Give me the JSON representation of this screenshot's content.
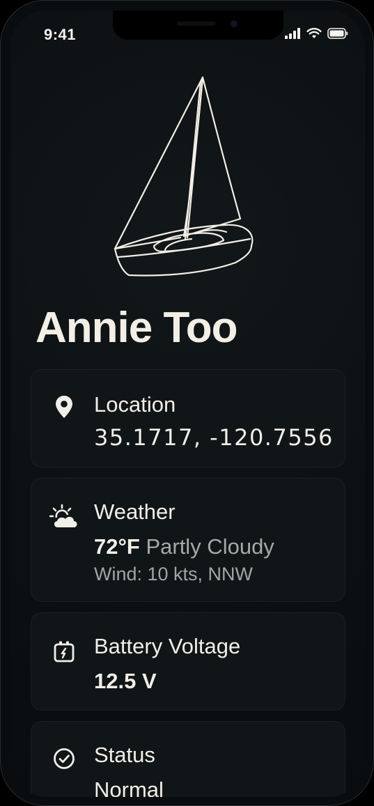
{
  "status_bar": {
    "time": "9:41"
  },
  "boat": {
    "name": "Annie Too"
  },
  "cards": {
    "location": {
      "title": "Location",
      "value": "35.1717, -120.7556",
      "icon": "location-pin-icon"
    },
    "weather": {
      "title": "Weather",
      "temperature": "72°F",
      "conditions": "Partly Cloudy",
      "wind": "Wind: 10 kts, NNW",
      "icon": "partly-cloudy-icon"
    },
    "battery": {
      "title": "Battery Voltage",
      "value": "12.5 V",
      "icon": "battery-icon"
    },
    "status": {
      "title": "Status",
      "value": "Normal",
      "icon": "check-circle-icon"
    }
  },
  "colors": {
    "background": "#0a0d0f",
    "card": "#101517",
    "text_primary": "#f2efe8",
    "text_secondary": "#a7a9a7"
  }
}
